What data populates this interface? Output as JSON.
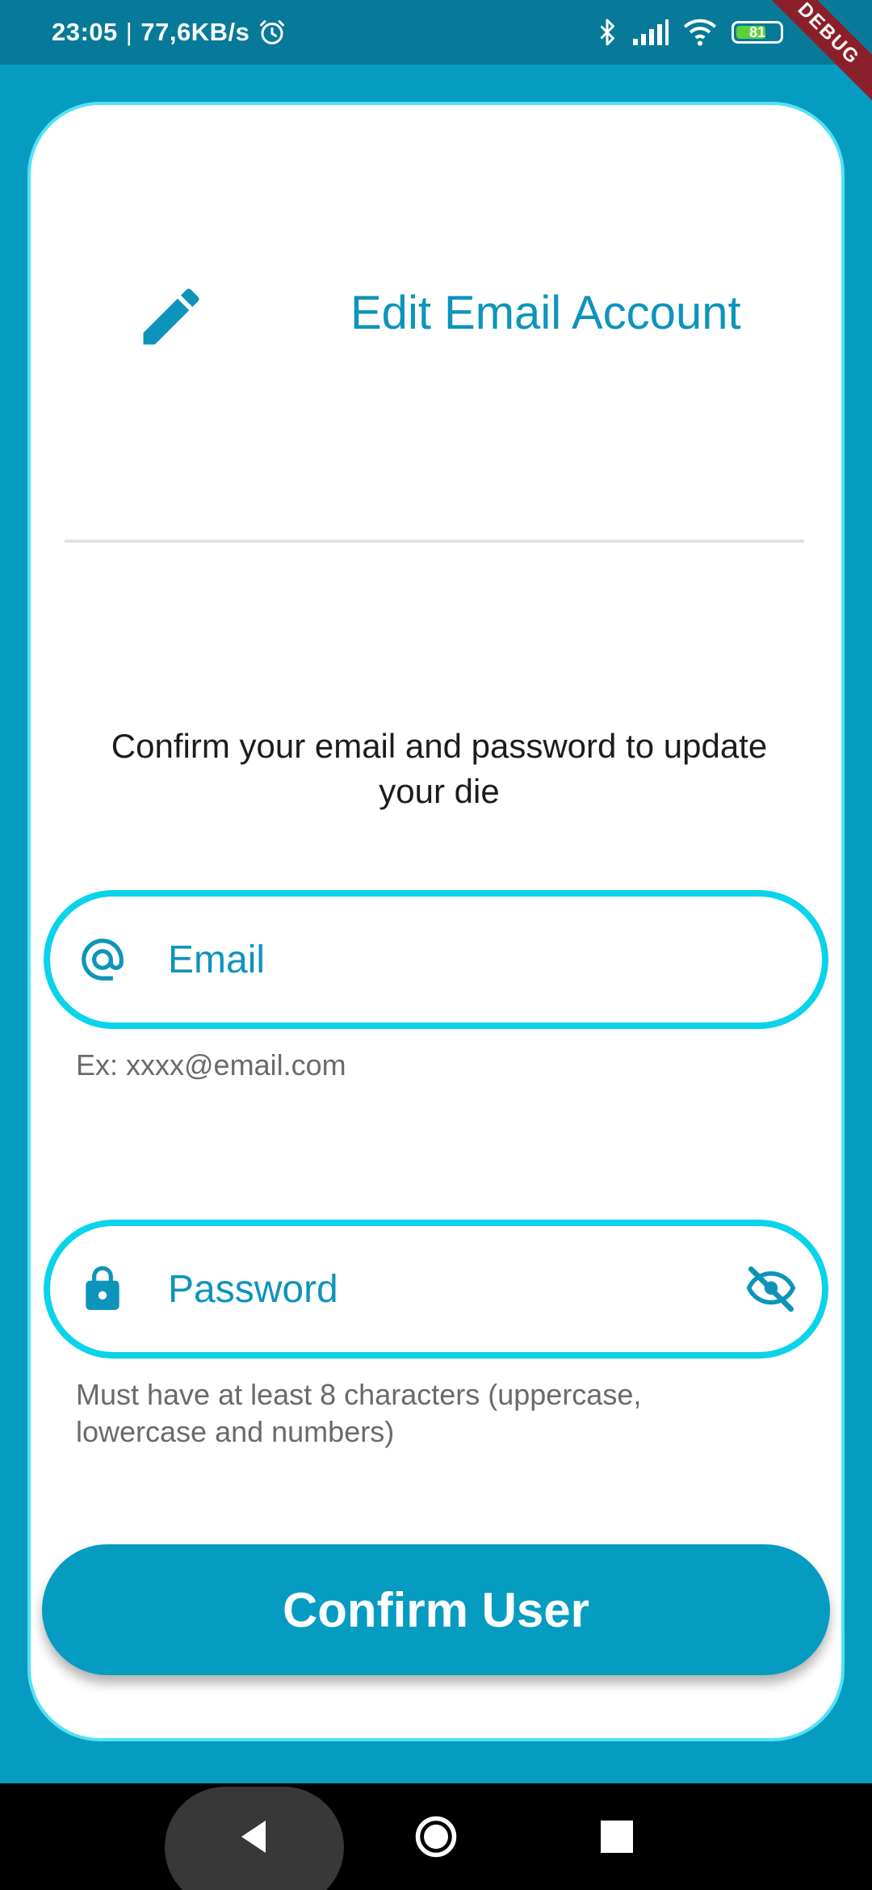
{
  "status_bar": {
    "time": "23:05",
    "separator": "|",
    "network_speed": "77,6KB/s",
    "battery_level": "81",
    "icons": [
      "alarm-icon",
      "bluetooth-icon",
      "signal-icon",
      "wifi-icon",
      "battery-icon"
    ],
    "debug_banner": "DEBUG"
  },
  "header": {
    "icon": "pencil-icon",
    "title": "Edit Email Account"
  },
  "form": {
    "subtitle": "Confirm your email and password to update your die",
    "email": {
      "icon": "at-icon",
      "label": "Email",
      "helper": "Ex: xxxx@email.com"
    },
    "password": {
      "icon": "lock-icon",
      "label": "Password",
      "toggle_icon": "eye-off-icon",
      "helper": "Must have at least 8 characters (uppercase, lowercase and numbers)"
    },
    "confirm_label": "Confirm User"
  },
  "nav": {
    "icons": [
      "back-icon",
      "home-icon",
      "recent-apps-icon"
    ]
  },
  "colors": {
    "primary": "#069cc2",
    "accent_border": "#0ad3ec",
    "title_text": "#0d94bb",
    "card_border": "#53e2f2"
  }
}
